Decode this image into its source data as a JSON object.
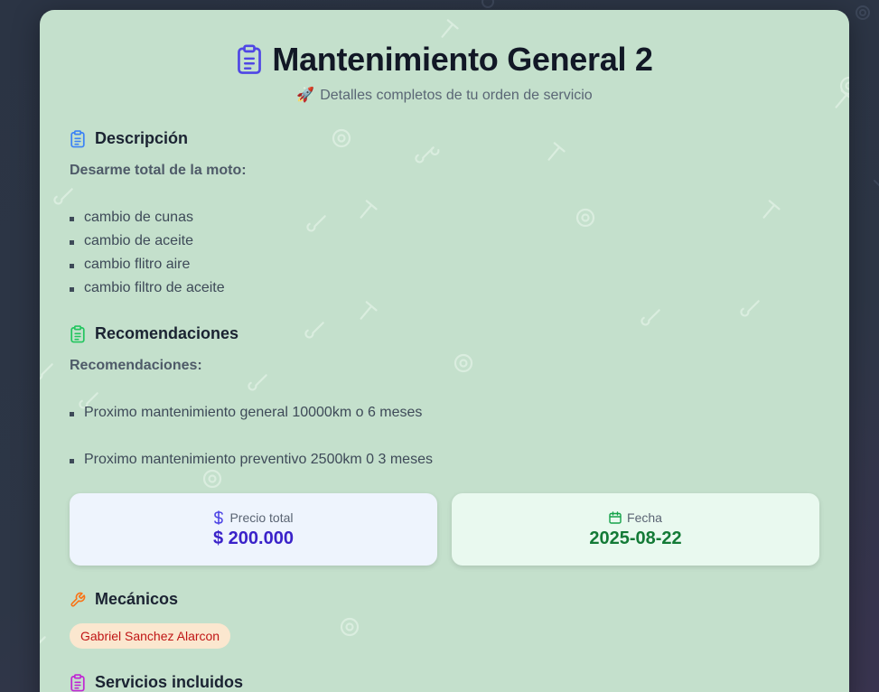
{
  "header": {
    "title": "Mantenimiento General 2",
    "subtitle": "Detalles completos de tu orden de servicio",
    "title_icon": "clipboard-icon",
    "subtitle_icon": "rocket-emoji"
  },
  "descripcion": {
    "heading": "Descripción",
    "intro": "Desarme total de la moto:",
    "items": [
      "cambio de cunas",
      "cambio de aceite",
      "cambio flitro aire",
      "cambio filtro de aceite"
    ]
  },
  "recomendaciones": {
    "heading": "Recomendaciones",
    "intro": "Recomendaciones:",
    "items": [
      "Proximo mantenimiento general 10000km o 6 meses",
      "Proximo mantenimiento preventivo 2500km 0 3 meses"
    ]
  },
  "precio": {
    "label": "Precio total",
    "value": "$ 200.000",
    "icon": "dollar-icon"
  },
  "fecha": {
    "label": "Fecha",
    "value": "2025-08-22",
    "icon": "calendar-icon"
  },
  "mecanicos": {
    "heading": "Mecánicos",
    "names": [
      "Gabriel Sanchez Alarcon"
    ],
    "icon": "wrench-icon"
  },
  "servicios": {
    "heading": "Servicios incluidos"
  },
  "colors": {
    "card_bg": "#c4e0cc",
    "page_bg": "#2b3444",
    "title_icon": "#4f46e5",
    "descripcion_icon": "#3b82f6",
    "recomendaciones_icon": "#22c55e",
    "mecanicos_icon": "#f97316",
    "servicios_icon": "#c026d3",
    "price_value": "#3a22c9",
    "date_value": "#137a36",
    "chip_bg": "#fbe7cf",
    "chip_text": "#c01515"
  }
}
